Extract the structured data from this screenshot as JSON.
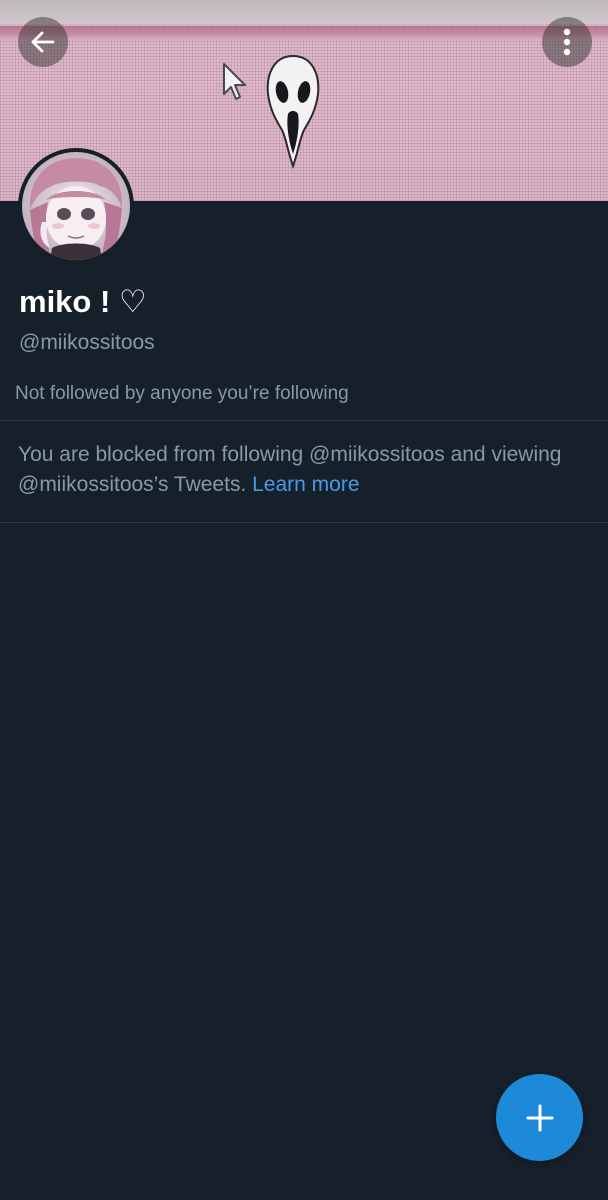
{
  "profile": {
    "display_name": "miko ! ♡",
    "handle": "@miikossitoos",
    "followed_by": "Not followed by anyone you’re following"
  },
  "blocked_notice": {
    "message": "You are blocked from following @miikossitoos and viewing @miikossitoos’s Tweets.",
    "link_label": "Learn more"
  },
  "icons": {
    "back": "arrow-left-icon",
    "more": "more-vertical-icon",
    "compose": "plus-icon"
  },
  "colors": {
    "background": "#16202a",
    "link": "#4a99e9",
    "fab": "#1d8ad9",
    "text_secondary": "#8b98a5"
  }
}
